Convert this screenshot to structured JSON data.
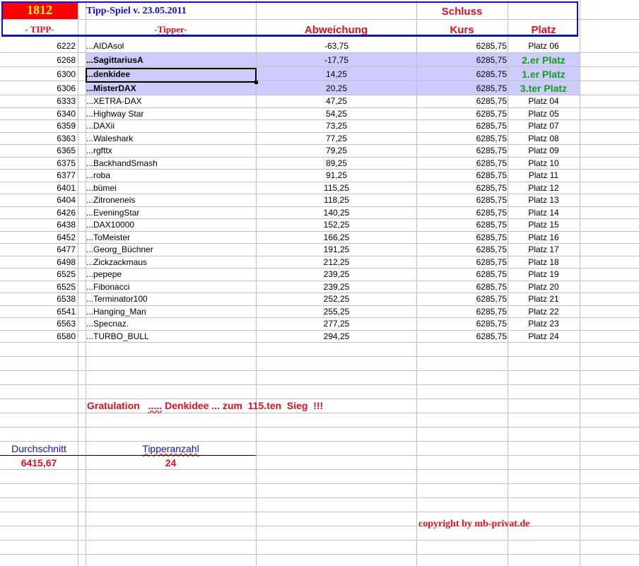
{
  "header": {
    "number": "1812",
    "title": "Tipp-Spiel v. 23.05.2011",
    "schluss": "Schluss",
    "col_tipp": "- TIPP-",
    "col_tipper": "-Tipper-",
    "col_abweichung": "Abweichung",
    "col_kurs": "Kurs",
    "col_platz": "Platz"
  },
  "rows": [
    {
      "tipp": "6222",
      "name": "...AIDAsol",
      "abw": "-63,75",
      "kurs": "6285,75",
      "platz": "Platz 06",
      "top": false
    },
    {
      "tipp": "6268",
      "name": "...SagittariusA",
      "abw": "-17,75",
      "kurs": "6285,75",
      "platz": "2.er Platz",
      "top": true
    },
    {
      "tipp": "6300",
      "name": "...denkidee",
      "abw": "14,25",
      "kurs": "6285,75",
      "platz": "1.er Platz",
      "top": true
    },
    {
      "tipp": "6306",
      "name": "...MisterDAX",
      "abw": "20,25",
      "kurs": "6285,75",
      "platz": "3.ter Platz",
      "top": true
    },
    {
      "tipp": "6333",
      "name": "...XETRA-DAX",
      "abw": "47,25",
      "kurs": "6285,75",
      "platz": "Platz 04",
      "top": false
    },
    {
      "tipp": "6340",
      "name": "...Highway Star",
      "abw": "54,25",
      "kurs": "6285,75",
      "platz": "Platz 05",
      "top": false
    },
    {
      "tipp": "6359",
      "name": "...DAXii",
      "abw": "73,25",
      "kurs": "6285,75",
      "platz": "Platz 07",
      "top": false
    },
    {
      "tipp": "6363",
      "name": "...Waleshark",
      "abw": "77,25",
      "kurs": "6285,75",
      "platz": "Platz 08",
      "top": false
    },
    {
      "tipp": "6365",
      "name": "...rgfttx",
      "abw": "79,25",
      "kurs": "6285,75",
      "platz": "Platz 09",
      "top": false
    },
    {
      "tipp": "6375",
      "name": "...BackhandSmash",
      "abw": "89,25",
      "kurs": "6285,75",
      "platz": "Platz 10",
      "top": false
    },
    {
      "tipp": "6377",
      "name": "...roba",
      "abw": "91,25",
      "kurs": "6285,75",
      "platz": "Platz 11",
      "top": false
    },
    {
      "tipp": "6401",
      "name": "...bümei",
      "abw": "115,25",
      "kurs": "6285,75",
      "platz": "Platz 12",
      "top": false
    },
    {
      "tipp": "6404",
      "name": "...Zitroneneis",
      "abw": "118,25",
      "kurs": "6285,75",
      "platz": "Platz 13",
      "top": false
    },
    {
      "tipp": "6426",
      "name": "...EveningStar",
      "abw": "140,25",
      "kurs": "6285,75",
      "platz": "Platz 14",
      "top": false
    },
    {
      "tipp": "6438",
      "name": "...DAX10000",
      "abw": "152,25",
      "kurs": "6285,75",
      "platz": "Platz 15",
      "top": false
    },
    {
      "tipp": "6452",
      "name": "...ToMeister",
      "abw": "166,25",
      "kurs": "6285,75",
      "platz": "Platz 16",
      "top": false
    },
    {
      "tipp": "6477",
      "name": "...Georg_Büchner",
      "abw": "191,25",
      "kurs": "6285,75",
      "platz": "Platz 17",
      "top": false
    },
    {
      "tipp": "6498",
      "name": "...Zickzackmaus",
      "abw": "212,25",
      "kurs": "6285,75",
      "platz": "Platz 18",
      "top": false
    },
    {
      "tipp": "6525",
      "name": "...pepepe",
      "abw": "239,25",
      "kurs": "6285,75",
      "platz": "Platz 19",
      "top": false
    },
    {
      "tipp": "6525",
      "name": "...Fibonacci",
      "abw": "239,25",
      "kurs": "6285,75",
      "platz": "Platz 20",
      "top": false
    },
    {
      "tipp": "6538",
      "name": "...Terminator100",
      "abw": "252,25",
      "kurs": "6285,75",
      "platz": "Platz 21",
      "top": false
    },
    {
      "tipp": "6541",
      "name": "...Hanging_Man",
      "abw": "255,25",
      "kurs": "6285,75",
      "platz": "Platz 22",
      "top": false
    },
    {
      "tipp": "6563",
      "name": "...Specnaz.",
      "abw": "277,25",
      "kurs": "6285,75",
      "platz": "Platz 23",
      "top": false
    },
    {
      "tipp": "6580",
      "name": "...TURBO_BULL",
      "abw": "294,25",
      "kurs": "6285,75",
      "platz": "Platz 24",
      "top": false
    }
  ],
  "footer": {
    "gratulation": "Gratulation",
    "dots": ".....",
    "message": "Denkidee ... zum  115.ten  Sieg  !!!",
    "avg_label": "Durchschnitt",
    "avg_value": "6415,67",
    "count_label": "Tipperanzahl",
    "count_value": "24",
    "copyright": "copyright by mb-privat.de"
  },
  "colors": {
    "header_red": "#ff0000",
    "number_yellow": "#ffff00",
    "title_blue": "#1010c8",
    "highlight": "#ccccff",
    "green": "#1a9a1a",
    "red_text": "#e01020"
  }
}
